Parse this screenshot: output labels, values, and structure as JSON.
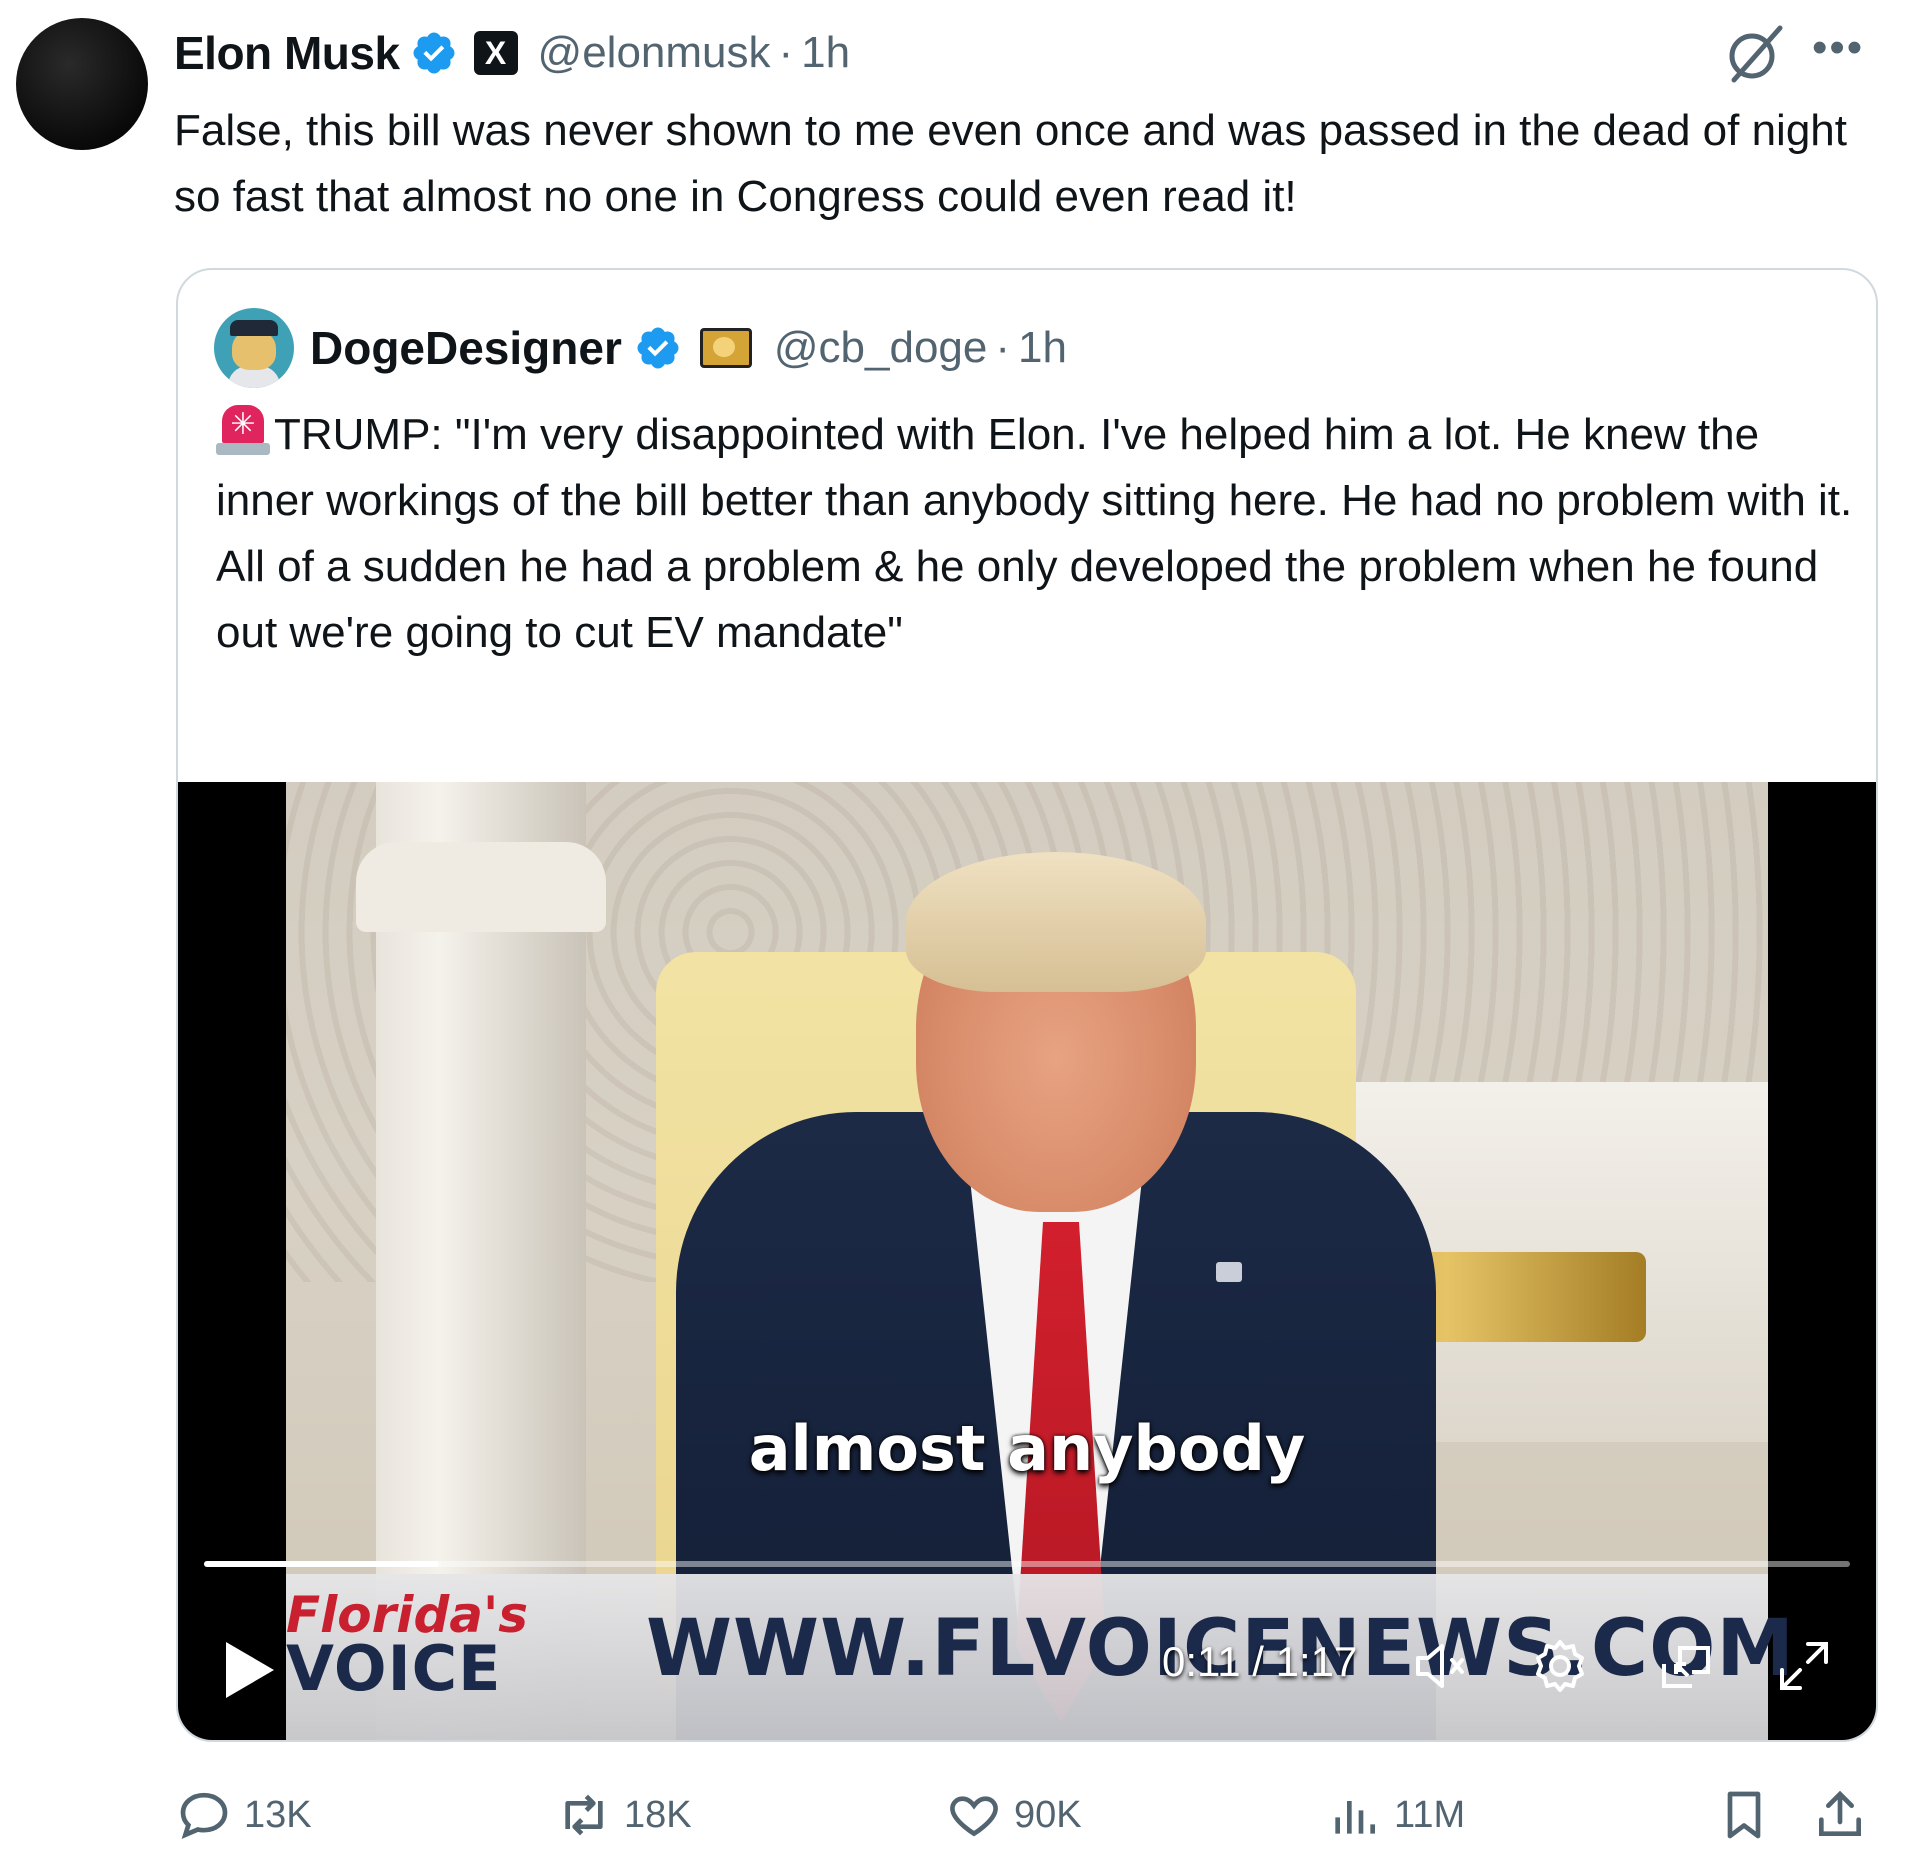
{
  "tweet": {
    "author_name": "Elon Musk",
    "handle": "@elonmusk",
    "separator": "·",
    "time": "1h",
    "affiliate_badge_label": "X",
    "text": "False, this bill was never shown to me even once and was passed in the dead of night so fast that almost no one in Congress could even read it!"
  },
  "quoted_tweet": {
    "author_name": "DogeDesigner",
    "handle": "@cb_doge",
    "separator": "·",
    "time": "1h",
    "siren_glyph": "✳",
    "text": "TRUMP: \"I'm very disappointed with Elon. I've helped him a lot. He knew the inner workings of the bill better than anybody sitting here. He had no problem with it. All of a sudden he had a problem & he only developed the problem when he found out we're going to cut EV mandate\""
  },
  "video": {
    "caption": "almost anybody",
    "logo_line1": "Florida's",
    "logo_line2": "VOICE",
    "lower_third_site": "WWW.FLVOICENEWS.COM",
    "time_display": "0:11 / 1:17",
    "elapsed_seconds": 11,
    "duration_seconds": 77,
    "muted": true
  },
  "actions": {
    "replies": "13K",
    "reposts": "18K",
    "likes": "90K",
    "views": "11M"
  },
  "colors": {
    "text_primary": "#0f1419",
    "text_secondary": "#536471",
    "verified_blue": "#1d9bf0",
    "border": "#cfd9de"
  }
}
